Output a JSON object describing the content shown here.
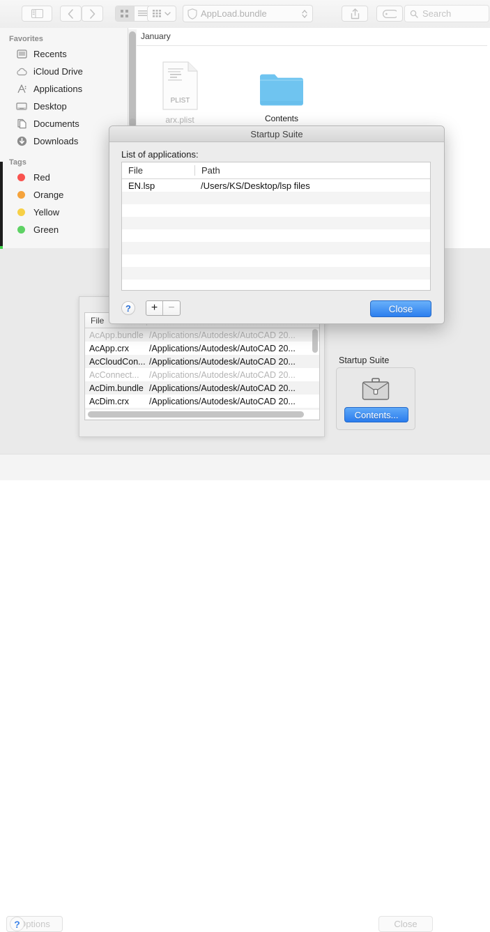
{
  "finder": {
    "toolbar": {
      "sidebar_toggle": "sidebar-toggle",
      "back": "‹",
      "forward": "›",
      "view_icon": "icon-view",
      "view_list": "list-view",
      "view_column": "column-view",
      "arrange": "arrange",
      "path_label": "AppLoad.bundle",
      "share": "share",
      "tag": "tag",
      "search_placeholder": "Search"
    },
    "sidebar": {
      "favorites_header": "Favorites",
      "favorites": [
        {
          "label": "Recents",
          "icon": "clock-recents-icon"
        },
        {
          "label": "iCloud Drive",
          "icon": "cloud-icon"
        },
        {
          "label": "Applications",
          "icon": "applications-icon"
        },
        {
          "label": "Desktop",
          "icon": "desktop-icon"
        },
        {
          "label": "Documents",
          "icon": "documents-icon"
        },
        {
          "label": "Downloads",
          "icon": "downloads-icon"
        }
      ],
      "tags_header": "Tags",
      "tags": [
        {
          "label": "Red",
          "color": "#f9534f"
        },
        {
          "label": "Orange",
          "color": "#f5a33c"
        },
        {
          "label": "Yellow",
          "color": "#f7d046"
        },
        {
          "label": "Green",
          "color": "#5ed264"
        }
      ]
    },
    "content": {
      "group_label": "January",
      "items": [
        {
          "label": "arx.plist",
          "type": "plist-file",
          "badge": "PLIST",
          "dimmed": true
        },
        {
          "label": "Contents",
          "type": "folder",
          "dimmed": false
        }
      ]
    }
  },
  "appload": {
    "list_headers": {
      "file": "File",
      "path": "Path"
    },
    "rows": [
      {
        "file": "AcApp.bundle",
        "path": "/Applications/Autodesk/AutoCAD 20...",
        "dimmed": true
      },
      {
        "file": "AcApp.crx",
        "path": "/Applications/Autodesk/AutoCAD 20...",
        "dimmed": false
      },
      {
        "file": "AcCloudCon...",
        "path": "/Applications/Autodesk/AutoCAD 20...",
        "dimmed": false
      },
      {
        "file": "AcConnect...",
        "path": "/Applications/Autodesk/AutoCAD 20...",
        "dimmed": true
      },
      {
        "file": "AcDim.bundle",
        "path": "/Applications/Autodesk/AutoCAD 20...",
        "dimmed": false
      },
      {
        "file": "AcDim.crx",
        "path": "/Applications/Autodesk/AutoCAD 20...",
        "dimmed": false
      }
    ],
    "suite_panel": {
      "title": "Startup Suite",
      "icon": "suitcase-icon",
      "button_label": "Contents..."
    },
    "bottom": {
      "help_label": "?",
      "options_label": "Options",
      "close_label": "Close"
    }
  },
  "suite_dialog": {
    "title": "Startup Suite",
    "subtitle": "List of applications:",
    "headers": {
      "file": "File",
      "path": "Path"
    },
    "rows": [
      {
        "file": "EN.lsp",
        "path": "/Users/KS/Desktop/lsp files"
      }
    ],
    "empty_row_count": 9,
    "help_label": "?",
    "add_label": "+",
    "remove_label": "−",
    "close_label": "Close"
  },
  "colors": {
    "accent_blue": "#2b7ced",
    "folder_blue": "#6fc4f0",
    "help_blue": "#2b6fd4"
  }
}
